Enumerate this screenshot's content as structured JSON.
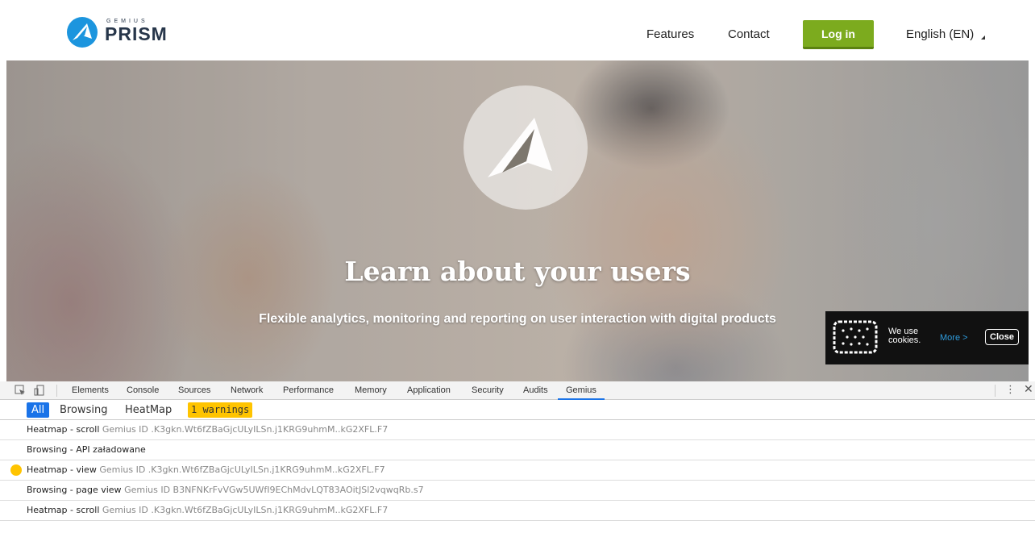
{
  "brand": {
    "sub": "GEMIUS",
    "name": "PRISM"
  },
  "nav": {
    "features": "Features",
    "contact": "Contact",
    "login": "Log in",
    "language": "English (EN)"
  },
  "hero": {
    "title": "Learn about your users",
    "subtitle": "Flexible analytics, monitoring and reporting on user interaction with digital products"
  },
  "cookie": {
    "text": "We use cookies.",
    "more": "More >",
    "close": "Close"
  },
  "devtools": {
    "tabs": [
      "Elements",
      "Console",
      "Sources",
      "Network",
      "Performance",
      "Memory",
      "Application",
      "Security",
      "Audits",
      "Gemius"
    ],
    "active_tab": "Gemius",
    "filters": {
      "all": "All",
      "browsing": "Browsing",
      "heatmap": "HeatMap",
      "warnings": "1 warnings"
    },
    "rows": [
      {
        "label": "Heatmap - scroll",
        "detail": "Gemius ID .K3gkn.Wt6fZBaGjcULyILSn.j1KRG9uhmM..kG2XFL.F7",
        "warning": false
      },
      {
        "label": "Browsing - API załadowane",
        "detail": "",
        "warning": false
      },
      {
        "label": "Heatmap - view",
        "detail": "Gemius ID .K3gkn.Wt6fZBaGjcULyILSn.j1KRG9uhmM..kG2XFL.F7",
        "warning": true
      },
      {
        "label": "Browsing - page view",
        "detail": "Gemius ID B3NFNKrFvVGw5UWfI9EChMdvLQT83AOitJSl2vqwqRb.s7",
        "warning": false
      },
      {
        "label": "Heatmap - scroll",
        "detail": "Gemius ID .K3gkn.Wt6fZBaGjcULyILSn.j1KRG9uhmM..kG2XFL.F7",
        "warning": false
      }
    ]
  },
  "colors": {
    "brand_blue": "#1c95de",
    "login_green": "#7cab1e",
    "devtools_accent": "#1a73e8",
    "warning": "#ffc400"
  }
}
